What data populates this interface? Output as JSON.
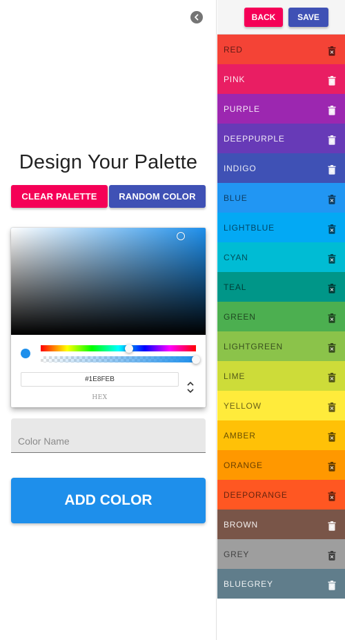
{
  "drawer": {
    "title": "Design Your Palette",
    "clear_label": "CLEAR PALETTE",
    "random_label": "RANDOM COLOR",
    "picker": {
      "hex_value": "#1E8FEB",
      "hex_mode_label": "HEX",
      "current_color": "#1e8feb",
      "hue_level": 0.57,
      "alpha_level": 1.0
    },
    "color_name_placeholder": "Color Name",
    "add_label": "ADD COLOR",
    "icons": {
      "close": "chevron-left-icon",
      "format_toggle": "unfold-icon"
    }
  },
  "toolbar": {
    "back_label": "BACK",
    "save_label": "SAVE"
  },
  "palette": [
    {
      "name": "RED",
      "color": "#f44336",
      "dark_text": true
    },
    {
      "name": "PINK",
      "color": "#e91e63",
      "dark_text": false
    },
    {
      "name": "PURPLE",
      "color": "#9c27b0",
      "dark_text": false
    },
    {
      "name": "DEEPPURPLE",
      "color": "#673ab7",
      "dark_text": false
    },
    {
      "name": "INDIGO",
      "color": "#3f51b5",
      "dark_text": false
    },
    {
      "name": "BLUE",
      "color": "#2196f3",
      "dark_text": true
    },
    {
      "name": "LIGHTBLUE",
      "color": "#03a9f4",
      "dark_text": true
    },
    {
      "name": "CYAN",
      "color": "#00bcd4",
      "dark_text": true
    },
    {
      "name": "TEAL",
      "color": "#009688",
      "dark_text": true
    },
    {
      "name": "GREEN",
      "color": "#4caf50",
      "dark_text": true
    },
    {
      "name": "LIGHTGREEN",
      "color": "#8bc34a",
      "dark_text": true
    },
    {
      "name": "LIME",
      "color": "#cddc39",
      "dark_text": true
    },
    {
      "name": "YELLOW",
      "color": "#ffeb3b",
      "dark_text": true
    },
    {
      "name": "AMBER",
      "color": "#ffc107",
      "dark_text": true
    },
    {
      "name": "ORANGE",
      "color": "#ff9800",
      "dark_text": true
    },
    {
      "name": "DEEPORANGE",
      "color": "#ff5722",
      "dark_text": true
    },
    {
      "name": "BROWN",
      "color": "#795548",
      "dark_text": false
    },
    {
      "name": "GREY",
      "color": "#9e9e9e",
      "dark_text": true
    },
    {
      "name": "BLUEGREY",
      "color": "#607d8b",
      "dark_text": false
    }
  ],
  "palette_delete_icon": "trash-icon"
}
